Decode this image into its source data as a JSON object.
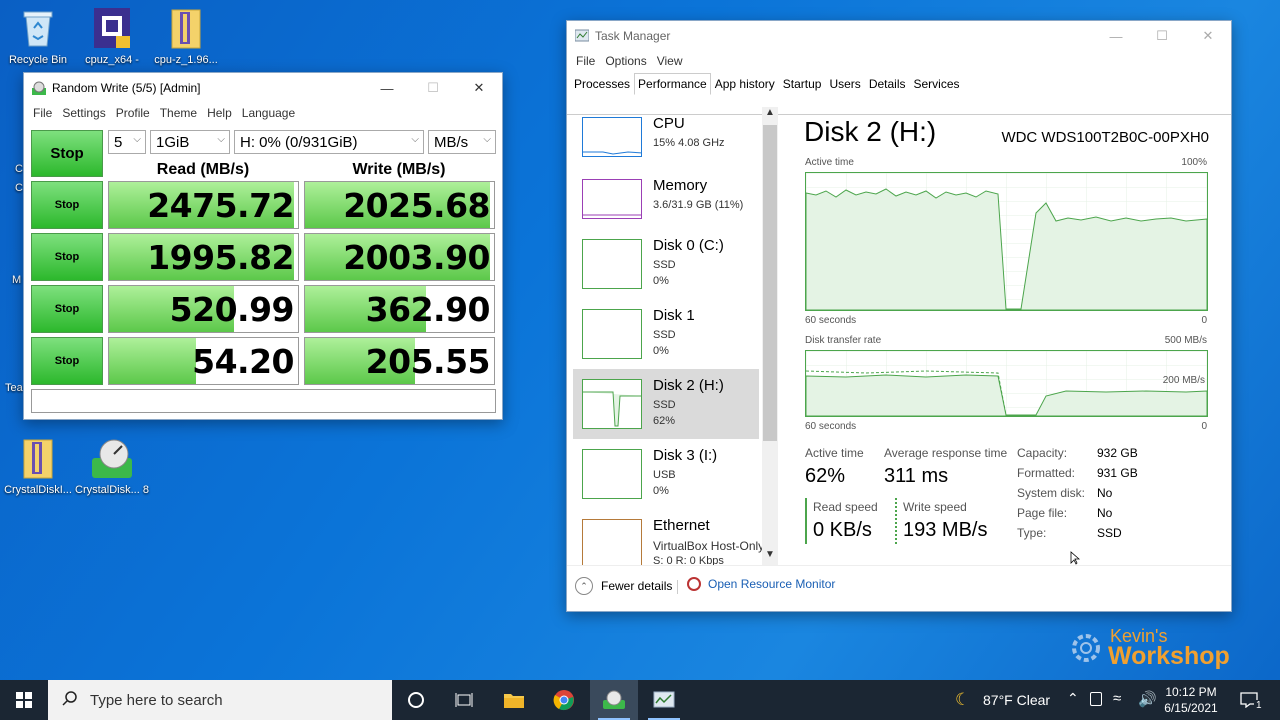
{
  "desktop": {
    "icons": [
      {
        "label": "Recycle Bin"
      },
      {
        "label": "cpuz_x64 -"
      },
      {
        "label": "cpu-z_1.96..."
      },
      {
        "label": "CrystalDiskI..."
      },
      {
        "label": "CrystalDisk... 8"
      }
    ],
    "partial_labels": [
      "C",
      "C",
      "M",
      "Tea"
    ],
    "watermark": {
      "line1": "Kevin's",
      "line2": "Workshop"
    }
  },
  "cdm": {
    "title": "Random Write (5/5) [Admin]",
    "menu": [
      "File",
      "Settings",
      "Profile",
      "Theme",
      "Help",
      "Language"
    ],
    "stop_main": "Stop",
    "count": "5",
    "size": "1GiB",
    "drive": "H: 0% (0/931GiB)",
    "unit": "MB/s",
    "read_header": "Read (MB/s)",
    "write_header": "Write (MB/s)",
    "rows": [
      {
        "stop": "Stop",
        "read": "2475.72",
        "write": "2025.68",
        "read_pct": 0.98,
        "write_pct": 0.98
      },
      {
        "stop": "Stop",
        "read": "1995.82",
        "write": "2003.90",
        "read_pct": 0.98,
        "write_pct": 0.98
      },
      {
        "stop": "Stop",
        "read": "520.99",
        "write": "362.90",
        "read_pct": 0.66,
        "write_pct": 0.64
      },
      {
        "stop": "Stop",
        "read": "54.20",
        "write": "205.55",
        "read_pct": 0.46,
        "write_pct": 0.58
      }
    ],
    "comment": ""
  },
  "tm": {
    "title": "Task Manager",
    "menu": [
      "File",
      "Options",
      "View"
    ],
    "tabs": [
      "Processes",
      "Performance",
      "App history",
      "Startup",
      "Users",
      "Details",
      "Services"
    ],
    "active_tab": "Performance",
    "sidebar": [
      {
        "name": "CPU",
        "s1": "15%  4.08 GHz",
        "s2": ""
      },
      {
        "name": "Memory",
        "s1": "3.6/31.9 GB (11%)",
        "s2": ""
      },
      {
        "name": "Disk 0 (C:)",
        "s1": "SSD",
        "s2": "0%"
      },
      {
        "name": "Disk 1",
        "s1": "SSD",
        "s2": "0%"
      },
      {
        "name": "Disk 2 (H:)",
        "s1": "SSD",
        "s2": "62%"
      },
      {
        "name": "Disk 3 (I:)",
        "s1": "USB",
        "s2": "0%"
      },
      {
        "name": "Ethernet",
        "s1": "VirtualBox Host-Only",
        "s2": "S: 0 R: 0 Kbps"
      }
    ],
    "disk_title": "Disk 2 (H:)",
    "disk_model": "WDC WDS100T2B0C-00PXH0",
    "graph1": {
      "label": "Active time",
      "max": "100%",
      "left_bottom": "60 seconds",
      "right_bottom": "0"
    },
    "graph2": {
      "label": "Disk transfer rate",
      "max": "500 MB/s",
      "mid": "200 MB/s",
      "left_bottom": "60 seconds",
      "right_bottom": "0"
    },
    "stats": {
      "active_time_label": "Active time",
      "active_time": "62%",
      "resp_label": "Average response time",
      "resp": "311 ms",
      "read_label": "Read speed",
      "read": "0 KB/s",
      "write_label": "Write speed",
      "write": "193 MB/s"
    },
    "props": [
      {
        "k": "Capacity:",
        "v": "932 GB"
      },
      {
        "k": "Formatted:",
        "v": "931 GB"
      },
      {
        "k": "System disk:",
        "v": "No"
      },
      {
        "k": "Page file:",
        "v": "No"
      },
      {
        "k": "Type:",
        "v": "SSD"
      }
    ],
    "fewer_details": "Fewer details",
    "open_resmon": "Open Resource Monitor"
  },
  "taskbar": {
    "search_placeholder": "Type here to search",
    "weather": "87°F  Clear",
    "time": "10:12 PM",
    "date": "6/15/2021",
    "notification_count": "1"
  }
}
